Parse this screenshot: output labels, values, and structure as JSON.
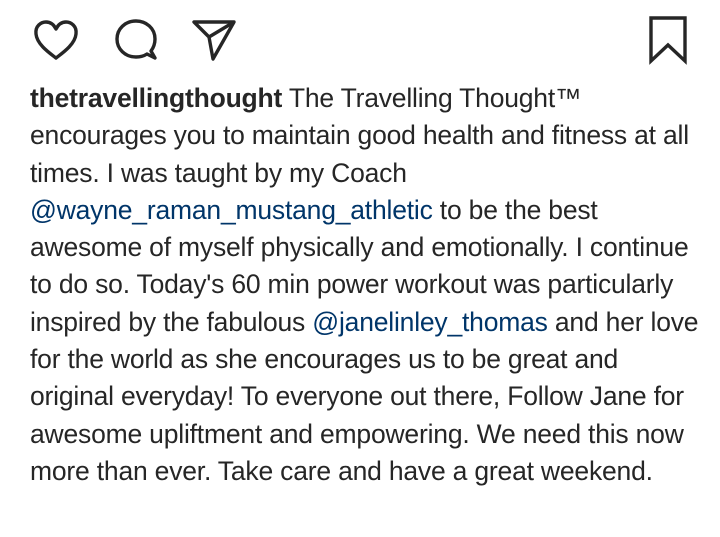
{
  "actions": {
    "like_icon": "heart-icon",
    "comment_icon": "speech-bubble-icon",
    "share_icon": "paper-plane-icon",
    "save_icon": "bookmark-icon"
  },
  "caption": {
    "username": "thetravellingthought",
    "text_1": " The Travelling Thought™ encourages you to maintain good health and fitness at all times. I was taught by my Coach ",
    "mention_1": "@wayne_raman_mustang_athletic",
    "text_2": " to be the best awesome of myself physically and emotionally. I continue to do so. Today's 60 min power workout was particularly inspired by the fabulous ",
    "mention_2": "@janelinley_thomas",
    "text_3": " and her love for the world as she encourages us to be great and original everyday! To everyone out there, Follow Jane for awesome upliftment and empowering. We need this now more than ever. Take care and have a great weekend."
  },
  "colors": {
    "text": "#262626",
    "mention": "#003569",
    "background": "#ffffff"
  }
}
